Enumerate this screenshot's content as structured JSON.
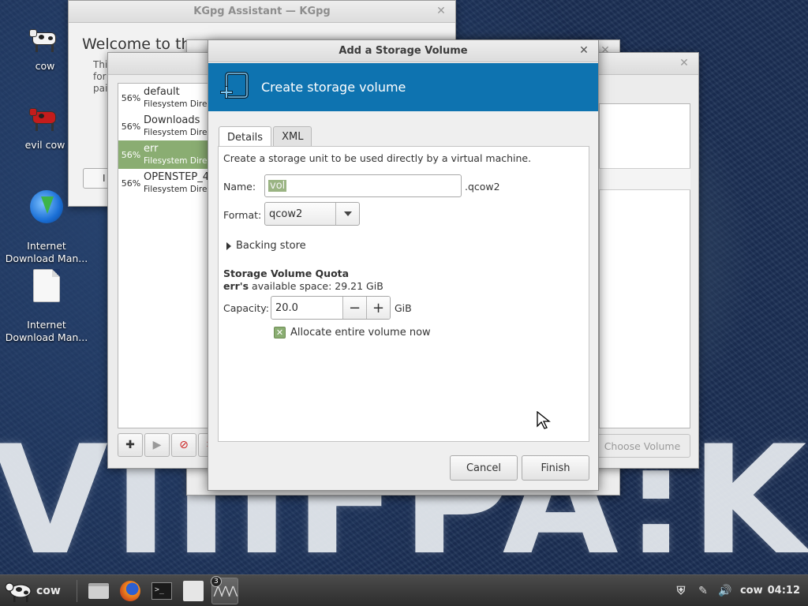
{
  "desktop": {
    "wallpaper_text": "VIIIFPA:K",
    "icons": [
      {
        "label": "cow"
      },
      {
        "label": "evil cow"
      },
      {
        "label": "Internet\nDownload Man..."
      },
      {
        "label": "Internet\nDownload Man..."
      }
    ]
  },
  "kgpg_window": {
    "title": "KGpg Assistant — KGpg",
    "welcome": "Welcome to the",
    "paragraph": "Thi\nfor\npai"
  },
  "pool_window": {
    "pools": [
      {
        "pct": "56%",
        "name": "default",
        "sub": "Filesystem Direc"
      },
      {
        "pct": "56%",
        "name": "Downloads",
        "sub": "Filesystem Direc"
      },
      {
        "pct": "56%",
        "name": "err",
        "sub": "Filesystem Direc"
      },
      {
        "pct": "56%",
        "name": "OPENSTEP_4",
        "sub": "Filesystem Direc"
      }
    ],
    "choose_volume": "Choose Volume"
  },
  "dialog": {
    "title": "Add a Storage Volume",
    "banner_title": "Create storage volume",
    "tabs": [
      "Details",
      "XML"
    ],
    "description": "Create a storage unit to be used directly by a virtual machine.",
    "name_label": "Name:",
    "name_value": "vol",
    "name_suffix": ".qcow2",
    "format_label": "Format:",
    "format_value": "qcow2",
    "backing_store": "Backing store",
    "quota_title": "Storage Volume Quota",
    "available_pool": "err's",
    "available_text": " available space: 29.21 GiB",
    "capacity_label": "Capacity:",
    "capacity_value": "20.0",
    "capacity_unit": "GiB",
    "allocate_label": "Allocate entire volume now",
    "allocate_checked": true,
    "cancel": "Cancel",
    "finish": "Finish"
  },
  "taskbar": {
    "menu_label": "cow",
    "badge": "3",
    "user": "cow",
    "clock": "04:12"
  },
  "colors": {
    "banner": "#0e73b0",
    "selection": "#8aad72"
  }
}
